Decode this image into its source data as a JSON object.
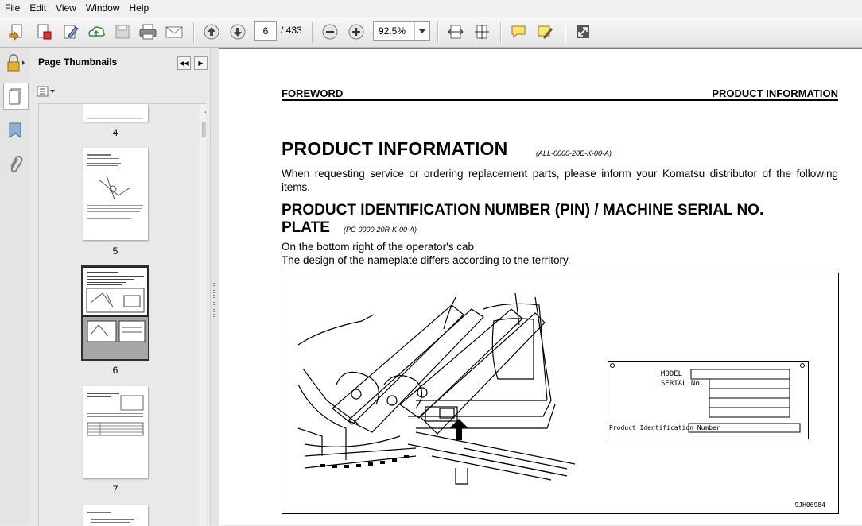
{
  "menu": [
    "File",
    "Edit",
    "View",
    "Window",
    "Help"
  ],
  "toolbar": {
    "page_current": "6",
    "page_total": "/ 433",
    "zoom": "92.5%"
  },
  "panel": {
    "title": "Page Thumbnails",
    "thumb_labels": [
      "4",
      "5",
      "6",
      "7"
    ]
  },
  "document": {
    "header_left": "FOREWORD",
    "header_right": "PRODUCT INFORMATION",
    "heading": "PRODUCT INFORMATION",
    "heading_code": "(ALL-0000-20E-K-00-A)",
    "intro": "When requesting service or ordering replacement parts, please inform your Komatsu distributor of the following items.",
    "subheading_line1": "PRODUCT IDENTIFICATION NUMBER (PIN) / MACHINE SERIAL NO.",
    "subheading_line2": "PLATE",
    "subheading_code": "(PC-0000-20R-K-00-A)",
    "line1": "On the bottom right of the operator's cab",
    "line2": "The design of the nameplate differs according to the territory.",
    "plate": {
      "model_label": "MODEL",
      "serial_label": "SERIAL No.",
      "pin_label": "Product Identification Number"
    },
    "figure_code": "9JH06984"
  }
}
